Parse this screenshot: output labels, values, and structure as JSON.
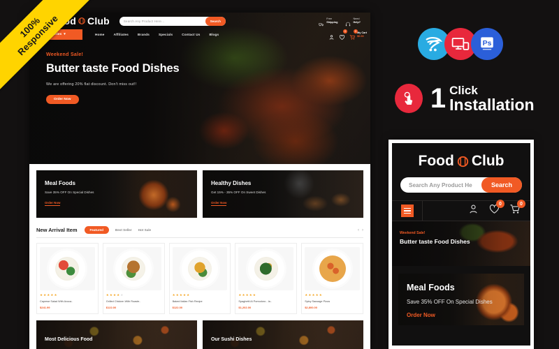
{
  "ribbon": {
    "line1": "100%",
    "line2": "Responsive"
  },
  "desktop": {
    "header": {
      "logo_food": "Food",
      "logo_club": "Club",
      "logo_icon": "plate-fork-knife-icon",
      "search_placeholder": "Search Any Product Here...",
      "search_button": "Search",
      "info": [
        {
          "icon": "truck-icon",
          "small": "Free",
          "strong": "Shipping"
        },
        {
          "icon": "headset-icon",
          "small": "Need",
          "strong": "Help?"
        }
      ],
      "cart_label": "My Cart",
      "cart_total": "$0.00",
      "wishlist_count": "0",
      "cart_count": "0"
    },
    "nav": {
      "all_categories": "All Categories",
      "links": [
        "Home",
        "Affiliates",
        "Brands",
        "Specials",
        "Contact Us",
        "Blogs"
      ]
    },
    "hero": {
      "kicker": "Weekend Sale!",
      "title": "Butter taste Food Dishes",
      "subtitle": "We are offering 20% flat discount. Don't miss out!!",
      "button": "Order Now"
    },
    "promos": [
      {
        "title": "Meal Foods",
        "subtitle": "Save 35% OFF On Special Dishes",
        "button": "Order Now"
      },
      {
        "title": "Healthy Dishes",
        "subtitle": "Get 15% - 35% OFF On Sweet Dishes",
        "button": "Order Now"
      }
    ],
    "arrival": {
      "heading": "New Arrival Item",
      "tabs": [
        {
          "label": "Featured",
          "active": true
        },
        {
          "label": "Best Seller",
          "active": false
        },
        {
          "label": "Hot Sale",
          "active": false
        }
      ],
      "prev": "‹",
      "next": "›"
    },
    "products": [
      {
        "name": "Caprese Salad With Avoca..",
        "price": "$241.99",
        "stars": 5
      },
      {
        "name": "Grilled Chicken With Roaste..",
        "price": "$122.00",
        "stars": 4
      },
      {
        "name": "Baked Italian Fish Recipe",
        "price": "$122.00",
        "stars": 5
      },
      {
        "name": "Spaghetti Al Pomodoro - Ia..",
        "price": "$1,202.00",
        "stars": 5
      },
      {
        "name": "Spicy Sausage Pizza",
        "price": "$2,800.00",
        "stars": 5
      }
    ],
    "bottom": [
      {
        "title": "Most Delicious Food"
      },
      {
        "title": "Our Sushi Dishes"
      }
    ]
  },
  "right": {
    "badges": [
      {
        "name": "opencart-icon"
      },
      {
        "name": "responsive-devices-icon"
      },
      {
        "name": "photoshop-icon",
        "label": "Ps"
      }
    ],
    "oneclick": {
      "icon": "click-hand-icon",
      "number": "1",
      "line1": "Click",
      "line2": "Installation"
    }
  },
  "mobile": {
    "logo_food": "Food",
    "logo_club": "Club",
    "search_placeholder": "Search Any Product He",
    "search_button": "Search",
    "wishlist_count": "0",
    "cart_count": "0",
    "hero": {
      "kicker": "Weekend Sale!",
      "title": "Butter taste Food Dishes"
    },
    "promo": {
      "title": "Meal Foods",
      "subtitle": "Save 35% OFF On Special Dishes",
      "button": "Order Now"
    }
  },
  "colors": {
    "accent": "#f15a24",
    "ribbon": "#ffd400",
    "red": "#e8283c",
    "blue": "#2b5fd9",
    "cyan": "#29abe2"
  }
}
